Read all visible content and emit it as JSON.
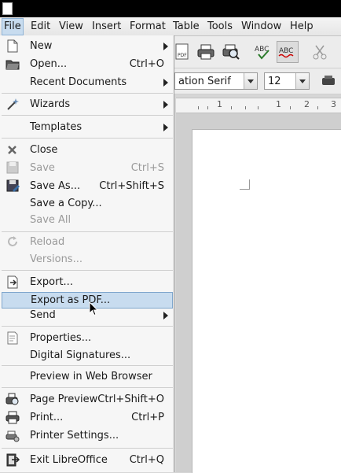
{
  "menubar": {
    "items": [
      {
        "label": "File",
        "active": true
      },
      {
        "label": "Edit"
      },
      {
        "label": "View"
      },
      {
        "label": "Insert"
      },
      {
        "label": "Format"
      },
      {
        "label": "Table"
      },
      {
        "label": "Tools"
      },
      {
        "label": "Window"
      },
      {
        "label": "Help"
      }
    ]
  },
  "toolbar": {
    "font_name": "ation Serif",
    "font_size": "12",
    "pdf_badge": "PDF"
  },
  "ruler": {
    "labels": [
      "1",
      "1",
      "2",
      "3"
    ]
  },
  "file_menu": {
    "items": [
      {
        "label": "New",
        "icon": "new-document-icon",
        "submenu": true
      },
      {
        "label": "Open...",
        "shortcut": "Ctrl+O",
        "icon": "open-folder-icon"
      },
      {
        "label": "Recent Documents",
        "submenu": true
      },
      {
        "label": "Wizards",
        "icon": "wizard-wand-icon",
        "submenu": true
      },
      {
        "label": "Templates",
        "submenu": true
      },
      {
        "label": "Close",
        "icon": "close-x-icon"
      },
      {
        "label": "Save",
        "shortcut": "Ctrl+S",
        "icon": "save-disk-icon",
        "disabled": true
      },
      {
        "label": "Save As...",
        "shortcut": "Ctrl+Shift+S",
        "icon": "save-as-icon"
      },
      {
        "label": "Save a Copy..."
      },
      {
        "label": "Save All",
        "disabled": true
      },
      {
        "label": "Reload",
        "icon": "reload-icon",
        "disabled": true
      },
      {
        "label": "Versions...",
        "disabled": true
      },
      {
        "label": "Export...",
        "icon": "export-icon"
      },
      {
        "label": "Export as PDF...",
        "highlighted": true
      },
      {
        "label": "Send",
        "submenu": true
      },
      {
        "label": "Properties...",
        "icon": "properties-icon"
      },
      {
        "label": "Digital Signatures..."
      },
      {
        "label": "Preview in Web Browser"
      },
      {
        "label": "Page Preview",
        "shortcut": "Ctrl+Shift+O",
        "icon": "page-preview-icon"
      },
      {
        "label": "Print...",
        "shortcut": "Ctrl+P",
        "icon": "printer-icon"
      },
      {
        "label": "Printer Settings...",
        "icon": "printer-settings-icon"
      },
      {
        "label": "Exit LibreOffice",
        "shortcut": "Ctrl+Q",
        "icon": "exit-icon"
      }
    ]
  },
  "colors": {
    "highlight_bg": "#c8dcef",
    "highlight_border": "#7fa6cc",
    "menu_bg": "#f6f6f6",
    "disabled_text": "#9a9a9a"
  }
}
